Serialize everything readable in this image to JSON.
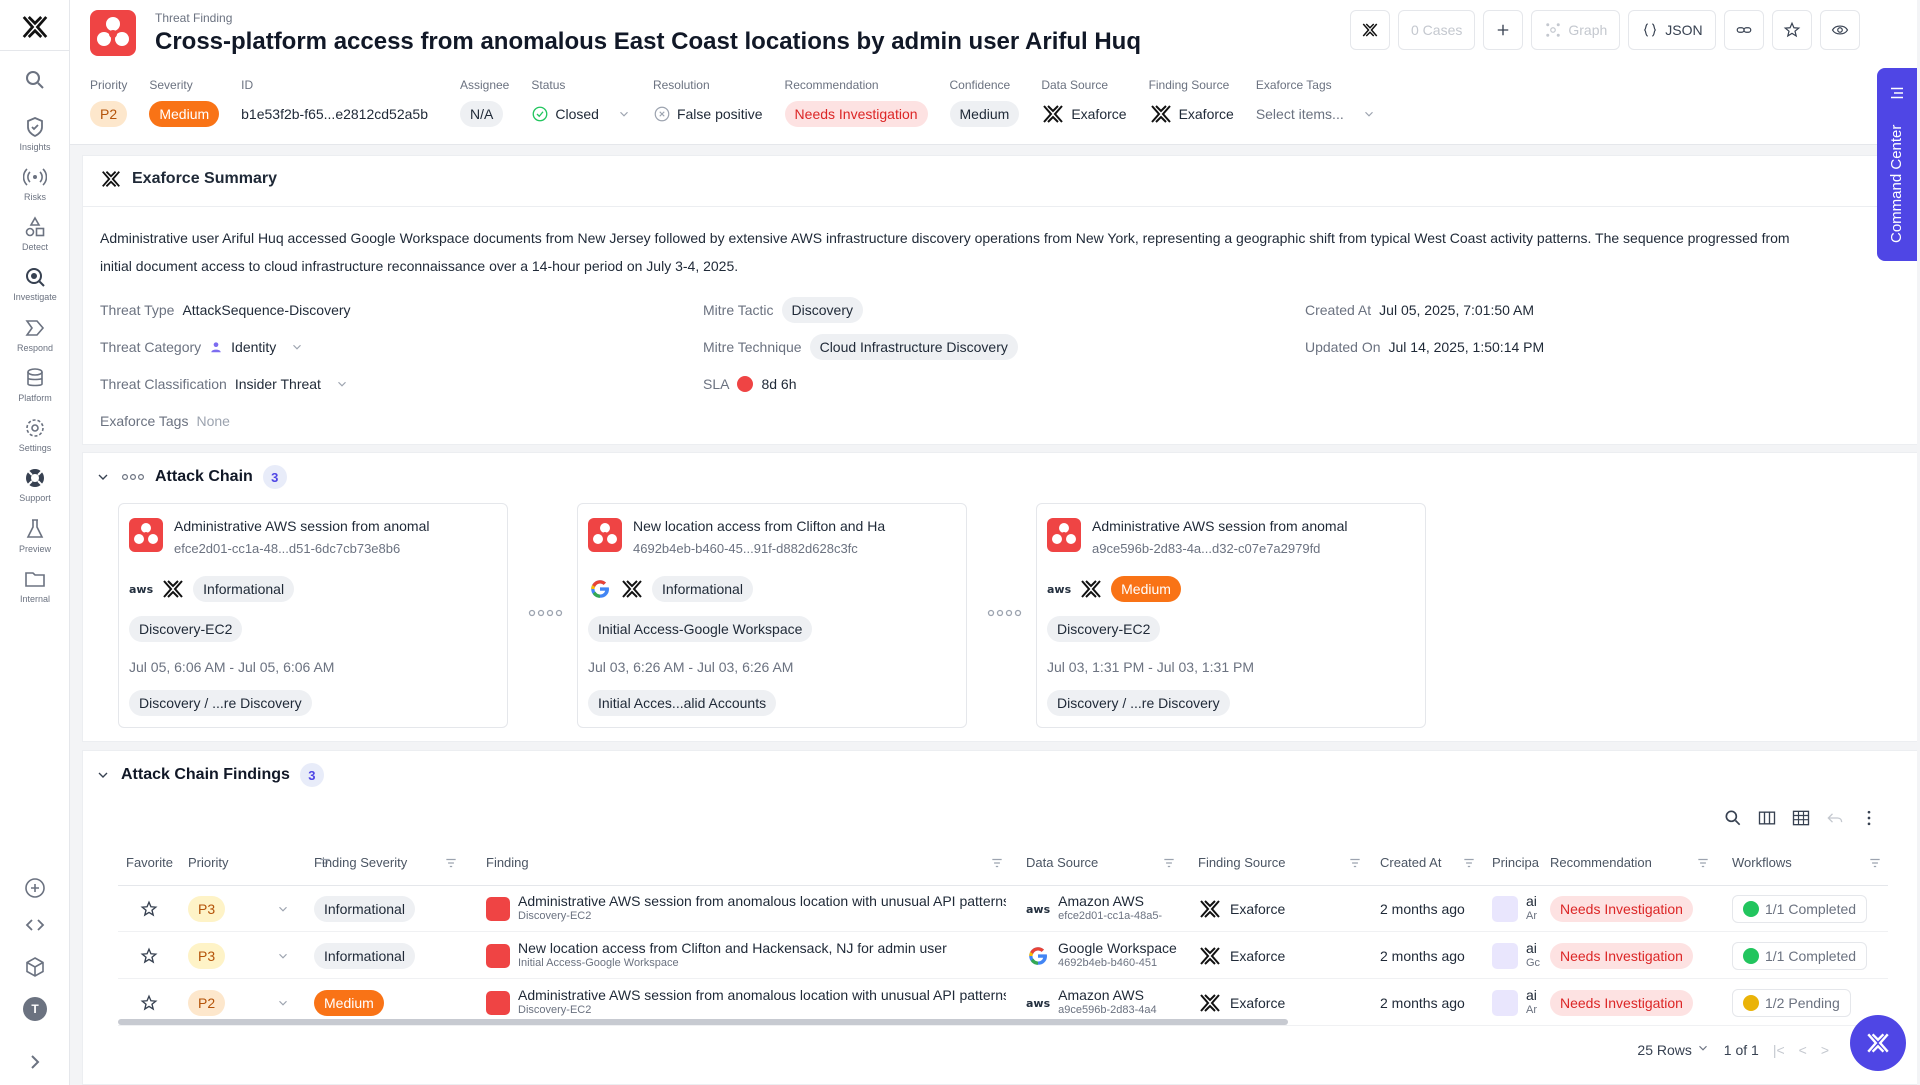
{
  "sidebar": {
    "items": [
      {
        "label": "Insights"
      },
      {
        "label": "Risks"
      },
      {
        "label": "Detect"
      },
      {
        "label": "Investigate"
      },
      {
        "label": "Respond"
      },
      {
        "label": "Platform"
      },
      {
        "label": "Settings"
      },
      {
        "label": "Support"
      },
      {
        "label": "Preview"
      },
      {
        "label": "Internal"
      }
    ],
    "avatar": "T"
  },
  "header": {
    "eyebrow": "Threat Finding",
    "title": "Cross-platform access from anomalous East Coast locations by admin user Ariful Huq",
    "cases": "0 Cases",
    "graph": "Graph",
    "json": "JSON"
  },
  "meta": {
    "priority_label": "Priority",
    "priority": "P2",
    "severity_label": "Severity",
    "severity": "Medium",
    "id_label": "ID",
    "id": "b1e53f2b-f65...e2812cd52a5b",
    "assignee_label": "Assignee",
    "assignee": "N/A",
    "status_label": "Status",
    "status": "Closed",
    "resolution_label": "Resolution",
    "resolution": "False positive",
    "recommendation_label": "Recommendation",
    "recommendation": "Needs Investigation",
    "confidence_label": "Confidence",
    "confidence": "Medium",
    "data_source_label": "Data Source",
    "data_source": "Exaforce",
    "finding_source_label": "Finding Source",
    "finding_source": "Exaforce",
    "tags_label": "Exaforce Tags",
    "tags_placeholder": "Select items..."
  },
  "summary": {
    "title": "Exaforce Summary",
    "text_line1": "Administrative user Ariful Huq accessed Google Workspace documents from New Jersey followed by extensive AWS infrastructure discovery operations from New York, representing a geographic shift from typical West Coast activity patterns. The sequence progressed from",
    "text_line2": "initial document access to cloud infrastructure reconnaissance over a 14-hour period on July 3-4, 2025.",
    "threat_type_label": "Threat Type",
    "threat_type": "AttackSequence-Discovery",
    "threat_category_label": "Threat Category",
    "threat_category": "Identity",
    "threat_classification_label": "Threat Classification",
    "threat_classification": "Insider Threat",
    "tags_label": "Exaforce Tags",
    "tags": "None",
    "mitre_tactic_label": "Mitre Tactic",
    "mitre_tactic": "Discovery",
    "mitre_technique_label": "Mitre Technique",
    "mitre_technique": "Cloud Infrastructure Discovery",
    "sla_label": "SLA",
    "sla": "8d 6h",
    "created_label": "Created At",
    "created": "Jul 05, 2025, 7:01:50 AM",
    "updated_label": "Updated On",
    "updated": "Jul 14, 2025, 1:50:14 PM"
  },
  "attack_chain": {
    "title": "Attack Chain",
    "count": "3",
    "cards": [
      {
        "title": "Administrative AWS session from anomal",
        "id": "efce2d01-cc1a-48...d51-6dc7cb73e8b6",
        "source": "aws",
        "severity": "Informational",
        "tag": "Discovery-EC2",
        "dates": "Jul 05, 6:06 AM - Jul 05, 6:06 AM",
        "technique": "Discovery / ...re Discovery"
      },
      {
        "title": "New location access from Clifton and Ha",
        "id": "4692b4eb-b460-45...91f-d882d628c3fc",
        "source": "google",
        "severity": "Informational",
        "tag": "Initial Access-Google Workspace",
        "dates": "Jul 03, 6:26 AM - Jul 03, 6:26 AM",
        "technique": "Initial Acces...alid Accounts"
      },
      {
        "title": "Administrative AWS session from anomal",
        "id": "a9ce596b-2d83-4a...d32-c07e7a2979fd",
        "source": "aws",
        "severity": "Medium",
        "tag": "Discovery-EC2",
        "dates": "Jul 03, 1:31 PM - Jul 03, 1:31 PM",
        "technique": "Discovery / ...re Discovery"
      }
    ]
  },
  "findings": {
    "title": "Attack Chain Findings",
    "count": "3",
    "columns": [
      "Favorite",
      "Priority",
      "Finding Severity",
      "Finding",
      "Data Source",
      "Finding Source",
      "Created At",
      "Principa",
      "Recommendation",
      "Workflows"
    ],
    "rows": [
      {
        "priority": "P3",
        "severity": "Informational",
        "finding": "Administrative AWS session from anomalous location with unusual API patterns",
        "finding_sub": "Discovery-EC2",
        "ds": "Amazon AWS",
        "ds_sub": "efce2d01-cc1a-48a5-",
        "ds_logo": "aws",
        "fs": "Exaforce",
        "created": "2 months ago",
        "pr1": "ai",
        "pr2": "Ar",
        "rec": "Needs Investigation",
        "wf": "1/1 Completed",
        "wf_state": "done"
      },
      {
        "priority": "P3",
        "severity": "Informational",
        "finding": "New location access from Clifton and Hackensack, NJ for admin user",
        "finding_sub": "Initial Access-Google Workspace",
        "ds": "Google Workspace",
        "ds_sub": "4692b4eb-b460-451",
        "ds_logo": "google",
        "fs": "Exaforce",
        "created": "2 months ago",
        "pr1": "ai",
        "pr2": "Gc",
        "rec": "Needs Investigation",
        "wf": "1/1 Completed",
        "wf_state": "done"
      },
      {
        "priority": "P2",
        "severity": "Medium",
        "finding": "Administrative AWS session from anomalous location with unusual API patterns",
        "finding_sub": "Discovery-EC2",
        "ds": "Amazon AWS",
        "ds_sub": "a9ce596b-2d83-4a4",
        "ds_logo": "aws",
        "fs": "Exaforce",
        "created": "2 months ago",
        "pr1": "ai",
        "pr2": "Ar",
        "rec": "Needs Investigation",
        "wf": "1/2 Pending",
        "wf_state": "pending"
      }
    ],
    "rows_per_page": "25 Rows",
    "page": "1",
    "of": "of 1"
  },
  "command_center": "Command Center",
  "colors": {
    "accent": "#4f46e5",
    "danger": "#ef4444",
    "medium": "#f97316"
  }
}
